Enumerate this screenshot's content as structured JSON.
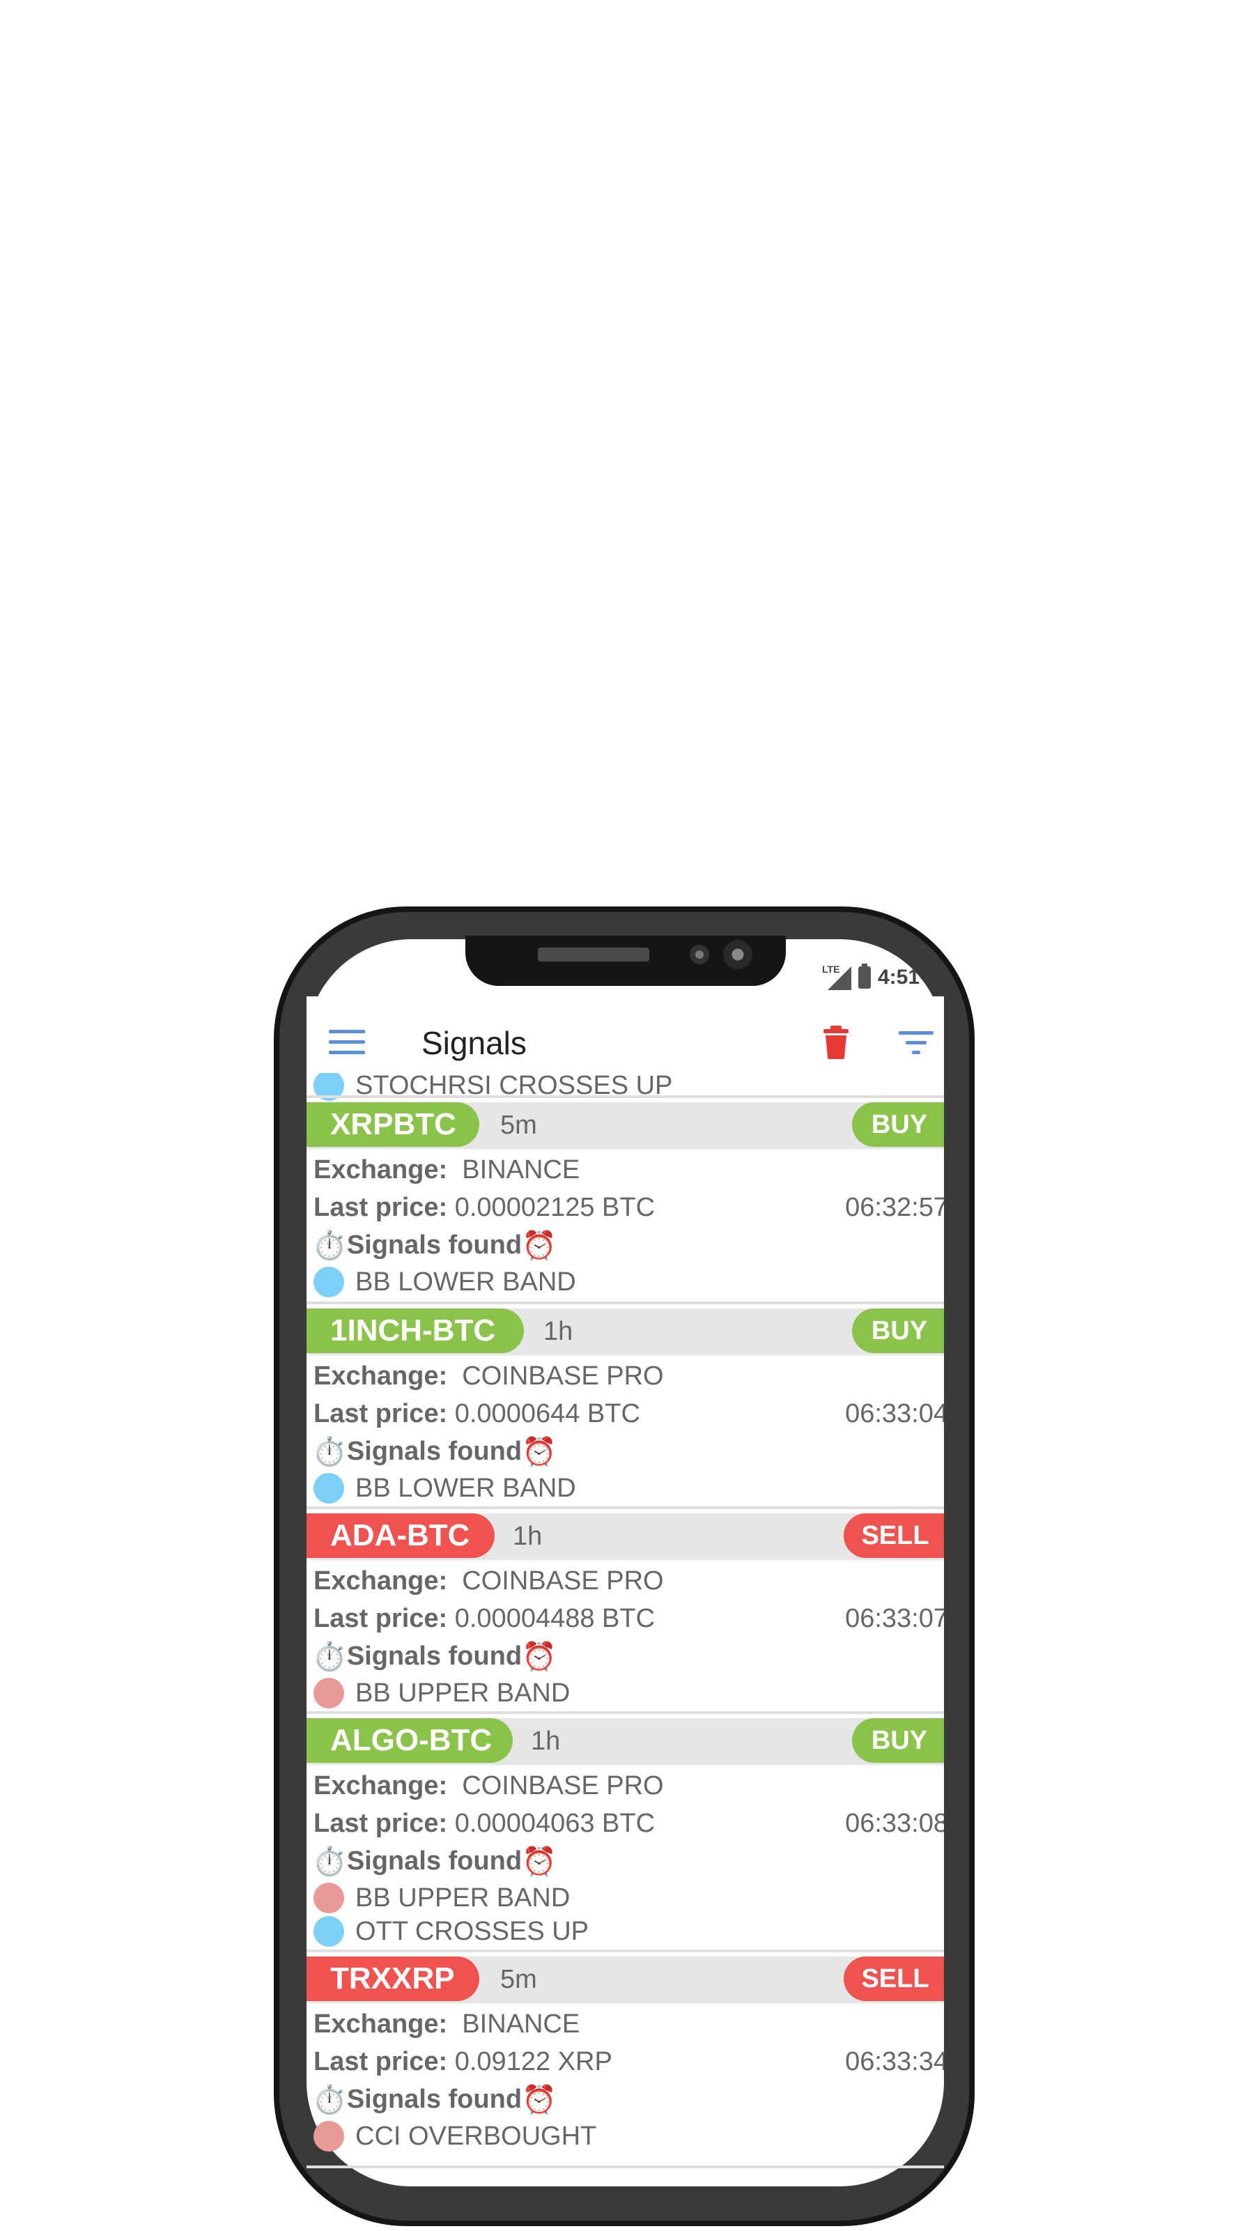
{
  "status_bar": {
    "network": "LTE",
    "time": "4:51"
  },
  "app_bar": {
    "title": "Signals"
  },
  "labels": {
    "exchange": "Exchange:",
    "last_price": "Last price:",
    "signals_found": "Signals found"
  },
  "partial_top_item": "STOCHRSI CROSSES UP",
  "signals": [
    {
      "pair": "XRPBTC",
      "timeframe": "5m",
      "signal": "BUY",
      "exchange": "BINANCE",
      "last_price": "0.00002125 BTC",
      "time": "06:32:57",
      "indicators": [
        {
          "name": "BB LOWER BAND",
          "color": "#7ccff6"
        }
      ]
    },
    {
      "pair": "1INCH-BTC",
      "timeframe": "1h",
      "signal": "BUY",
      "exchange": "COINBASE PRO",
      "last_price": "0.0000644 BTC",
      "time": "06:33:04",
      "indicators": [
        {
          "name": "BB LOWER BAND",
          "color": "#7ccff6"
        }
      ]
    },
    {
      "pair": "ADA-BTC",
      "timeframe": "1h",
      "signal": "SELL",
      "exchange": "COINBASE PRO",
      "last_price": "0.00004488 BTC",
      "time": "06:33:07",
      "indicators": [
        {
          "name": "BB UPPER BAND",
          "color": "#ea9a96"
        }
      ]
    },
    {
      "pair": "ALGO-BTC",
      "timeframe": "1h",
      "signal": "BUY",
      "exchange": "COINBASE PRO",
      "last_price": "0.00004063 BTC",
      "time": "06:33:08",
      "indicators": [
        {
          "name": "BB UPPER BAND",
          "color": "#ea9a96"
        },
        {
          "name": "OTT CROSSES UP",
          "color": "#7ccff6"
        }
      ]
    },
    {
      "pair": "TRXXRP",
      "timeframe": "5m",
      "signal": "SELL",
      "exchange": "BINANCE",
      "last_price": "0.09122 XRP",
      "time": "06:33:34",
      "indicators": [
        {
          "name": "CCI OVERBOUGHT",
          "color": "#ea9a96"
        }
      ]
    }
  ],
  "colors": {
    "buy": "#8bc34a",
    "sell": "#ef5350",
    "accent": "#5b8fd9",
    "delete": "#e53935"
  }
}
